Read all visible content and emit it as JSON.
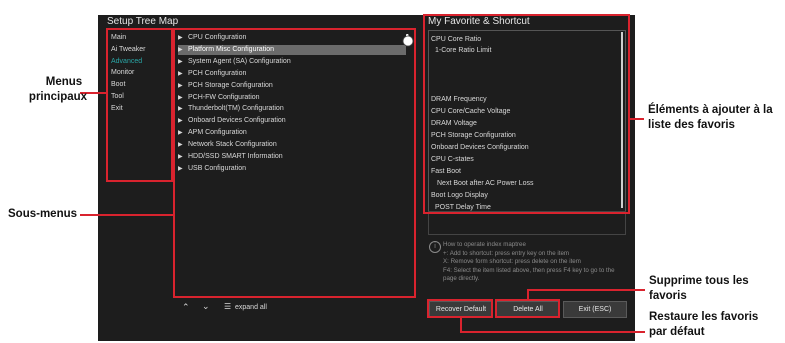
{
  "bios": {
    "tree_title": "Setup Tree Map",
    "fav_title": "My Favorite & Shortcut",
    "menus": [
      {
        "label": "Main",
        "active": false
      },
      {
        "label": "Ai Tweaker",
        "active": false
      },
      {
        "label": "Advanced",
        "active": true
      },
      {
        "label": "Monitor",
        "active": false
      },
      {
        "label": "Boot",
        "active": false
      },
      {
        "label": "Tool",
        "active": false
      },
      {
        "label": "Exit",
        "active": false
      }
    ],
    "submenus": [
      "CPU Configuration",
      "Platform Misc Configuration",
      "System Agent (SA) Configuration",
      "PCH Configuration",
      "PCH Storage Configuration",
      "PCH-FW Configuration",
      "Thunderbolt(TM) Configuration",
      "Onboard Devices Configuration",
      "APM Configuration",
      "Network Stack Configuration",
      "HDD/SSD SMART Information",
      "USB Configuration"
    ],
    "selected_submenu": "Platform Misc Configuration",
    "favorites": [
      "CPU Core Ratio",
      "1-Core Ratio Limit",
      "DRAM Frequency",
      "CPU Core/Cache Voltage",
      "DRAM Voltage",
      "PCH Storage Configuration",
      "Onboard Devices Configuration",
      "CPU C-states",
      "Fast Boot",
      "Next Boot after AC Power Loss",
      "Boot Logo Display",
      "POST Delay Time"
    ],
    "help": {
      "title": "How to operate index maptree",
      "lines": [
        "+: Add to shortcut: press entry key on the item",
        "X: Remove form shortcut: press delete on the item",
        "F4: Select the item listed above, then press F4 key to go to the page directly."
      ]
    },
    "bottom": {
      "expand_all": "expand all"
    },
    "buttons": {
      "recover": "Recover Default",
      "delete_all": "Delete All",
      "exit": "Exit (ESC)"
    }
  },
  "annotations": {
    "menus_principaux": [
      "Menus",
      "principaux"
    ],
    "sous_menus": "Sous-menus",
    "elements_favoris": [
      "Éléments à ajouter à la",
      "liste des favoris"
    ],
    "supprime": [
      "Supprime tous les",
      "favoris"
    ],
    "restaure": [
      "Restaure les favoris",
      "par défaut"
    ]
  },
  "colors": {
    "highlight_red": "#d9232e",
    "active_menu": "#2aa6a6",
    "screen_bg": "#1d1d1d"
  }
}
